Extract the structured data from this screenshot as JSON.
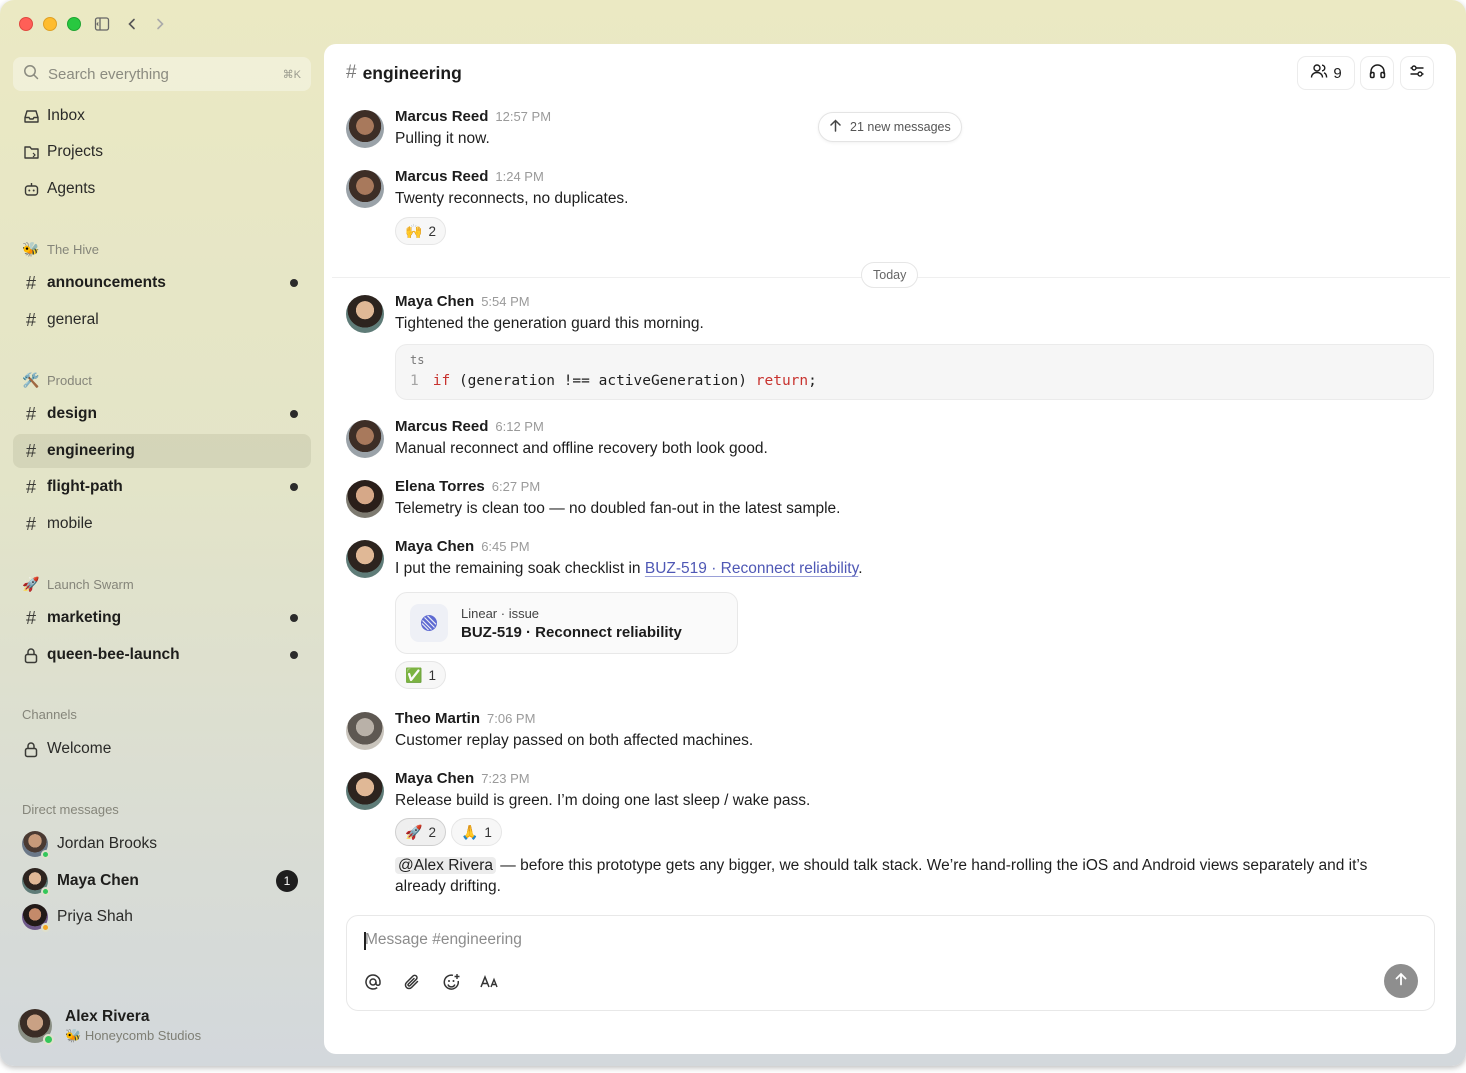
{
  "sidebar": {
    "search": {
      "placeholder": "Search everything",
      "shortcut": "⌘K"
    },
    "top_nav": [
      {
        "label": "Inbox",
        "icon": "inbox-icon"
      },
      {
        "label": "Projects",
        "icon": "projects-icon"
      },
      {
        "label": "Agents",
        "icon": "agents-icon"
      }
    ],
    "workspaces": [
      {
        "name": "The Hive",
        "emoji": "🐝",
        "channels": [
          {
            "label": "announcements",
            "unread": true,
            "bold": true
          },
          {
            "label": "general",
            "unread": false,
            "bold": false
          }
        ]
      },
      {
        "name": "Product",
        "emoji": "🛠️",
        "channels": [
          {
            "label": "design",
            "unread": true,
            "bold": true
          },
          {
            "label": "engineering",
            "unread": false,
            "bold": true,
            "active": true
          },
          {
            "label": "flight-path",
            "unread": true,
            "bold": true
          },
          {
            "label": "mobile",
            "unread": false,
            "bold": false
          }
        ]
      },
      {
        "name": "Launch Swarm",
        "emoji": "🚀",
        "channels": [
          {
            "label": "marketing",
            "unread": true,
            "bold": true
          },
          {
            "label": "queen-bee-launch",
            "unread": true,
            "bold": true,
            "private": true
          }
        ]
      }
    ],
    "channels_section": {
      "title": "Channels",
      "items": [
        {
          "label": "Welcome",
          "private": true
        }
      ]
    },
    "dm_section": {
      "title": "Direct messages",
      "items": [
        {
          "label": "Jordan Brooks",
          "status": "online",
          "badge": ""
        },
        {
          "label": "Maya Chen",
          "status": "online",
          "badge": "1",
          "bold": true
        },
        {
          "label": "Priya Shah",
          "status": "away",
          "badge": ""
        }
      ]
    },
    "current_user": {
      "name": "Alex Rivera",
      "org_emoji": "🐝",
      "org": "Honeycomb Studios"
    }
  },
  "header": {
    "channel": "engineering",
    "member_count": "9"
  },
  "new_messages": "21 new messages",
  "day_divider": "Today",
  "messages": {
    "m1": {
      "author": "Marcus Reed",
      "time": "12:57 PM",
      "text": "Pulling it now."
    },
    "m2": {
      "author": "Marcus Reed",
      "time": "1:24 PM",
      "text": "Twenty reconnects, no duplicates.",
      "reaction": {
        "emoji": "🙌",
        "count": "2"
      }
    },
    "m3": {
      "author": "Maya Chen",
      "time": "5:54 PM",
      "text": "Tightened the generation guard this morning.",
      "code": {
        "lang": "ts",
        "line_no": "1",
        "kw1": "if",
        "mid": "(generation !== activeGeneration)",
        "kw2": "return",
        "end": ";"
      }
    },
    "m4": {
      "author": "Marcus Reed",
      "time": "6:12 PM",
      "text": "Manual reconnect and offline recovery both look good."
    },
    "m5": {
      "author": "Elena Torres",
      "time": "6:27 PM",
      "text": "Telemetry is clean too — no doubled fan-out in the latest sample."
    },
    "m6": {
      "author": "Maya Chen",
      "time": "6:45 PM",
      "text_before": "I put the remaining soak checklist in ",
      "link": "BUZ-519 · Reconnect reliability",
      "text_after": ".",
      "card": {
        "source": "Linear · issue",
        "title": "BUZ-519 · Reconnect reliability"
      },
      "reaction": {
        "emoji": "✅",
        "count": "1"
      }
    },
    "m7": {
      "author": "Theo Martin",
      "time": "7:06 PM",
      "text": "Customer replay passed on both affected machines."
    },
    "m8": {
      "author": "Maya Chen",
      "time": "7:23 PM",
      "text": "Release build is green. I’m doing one last sleep / wake pass.",
      "reactions": [
        {
          "emoji": "🚀",
          "count": "2",
          "mine": true
        },
        {
          "emoji": "🙏",
          "count": "1",
          "mine": false
        }
      ]
    },
    "m9": {
      "mention": "@Alex Rivera",
      "text": " — before this prototype gets any bigger, we should talk stack. We’re hand-rolling the iOS and Android views separately and it’s already drifting."
    }
  },
  "composer": {
    "placeholder": "Message #engineering"
  },
  "colors": {
    "accent_link": "#4f58b5",
    "online": "#34c759",
    "away": "#f5a623",
    "code_keyword": "#c8322e"
  }
}
